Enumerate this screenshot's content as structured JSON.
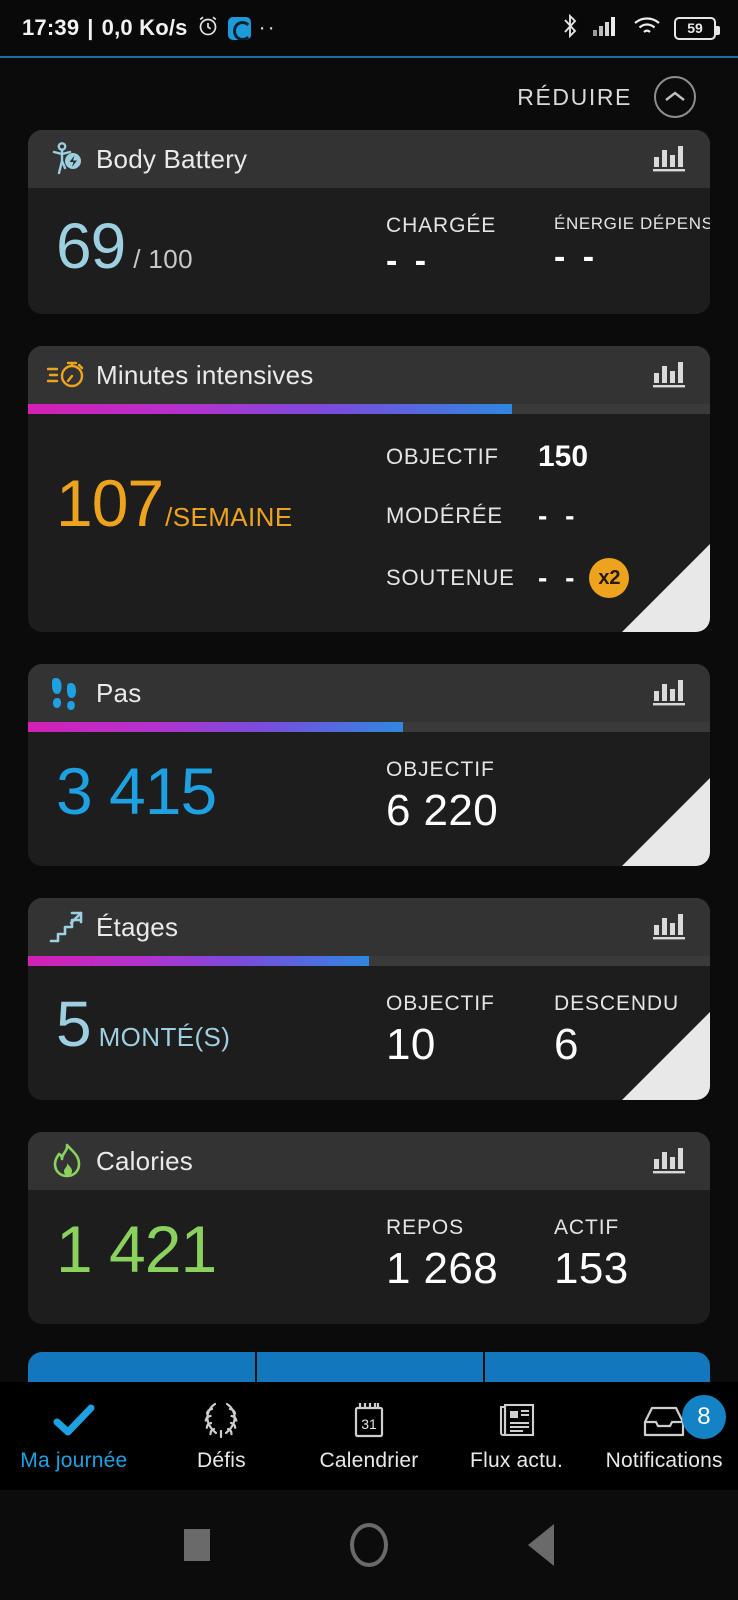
{
  "status_bar": {
    "time": "17:39",
    "separator": "|",
    "network_speed": "0,0 Ko/s",
    "alarm_icon": "alarm-clock-icon",
    "app_icon": "app-icon",
    "more_dots": "··",
    "bluetooth_icon": "bluetooth-icon",
    "signal_icon": "cellular-signal-icon",
    "wifi_icon": "wifi-icon",
    "battery_level": "59"
  },
  "header": {
    "reduce_label": "RÉDUIRE",
    "reduce_icon": "chevron-up-circle-icon"
  },
  "cards": [
    {
      "id": "body-battery",
      "title": "Body Battery",
      "icon": "body-battery-icon",
      "accent": "#9dcfe0",
      "value": "69",
      "unit": "/ 100",
      "has_progress": false,
      "has_corner": false,
      "layout": "columns",
      "stats": [
        {
          "label": "CHARGÉE",
          "value": "- -",
          "small_label": false
        },
        {
          "label": "ÉNERGIE DÉPENSÉE",
          "value": "- -",
          "small_label": true
        }
      ]
    },
    {
      "id": "minutes-intensives",
      "title": "Minutes intensives",
      "icon": "stopwatch-icon",
      "accent": "#eda31e",
      "value": "107",
      "unit": "/SEMAINE",
      "has_progress": true,
      "progress_percent": 71,
      "has_corner": true,
      "layout": "rows",
      "stats": [
        {
          "label": "OBJECTIF",
          "value": "150",
          "badge": ""
        },
        {
          "label": "MODÉRÉE",
          "value": "- -",
          "badge": ""
        },
        {
          "label": "SOUTENUE",
          "value": "- -",
          "badge": "x2"
        }
      ]
    },
    {
      "id": "pas",
      "title": "Pas",
      "icon": "footprints-icon",
      "accent": "#1ea1e2",
      "value": "3 415",
      "unit": "",
      "has_progress": true,
      "progress_percent": 55,
      "has_corner": true,
      "layout": "columns",
      "stats": [
        {
          "label": "OBJECTIF",
          "value": "6 220",
          "small_label": false
        }
      ]
    },
    {
      "id": "etages",
      "title": "Étages",
      "icon": "stairs-icon",
      "accent": "#9dcfe0",
      "value": "5",
      "unit": "MONTÉ(S)",
      "has_progress": true,
      "progress_percent": 50,
      "has_corner": true,
      "layout": "columns",
      "stats": [
        {
          "label": "OBJECTIF",
          "value": "10",
          "small_label": false
        },
        {
          "label": "DESCENDU",
          "value": "6",
          "small_label": false
        }
      ]
    },
    {
      "id": "calories",
      "title": "Calories",
      "icon": "flame-icon",
      "accent": "#8bd15e",
      "value": "1 421",
      "unit": "",
      "has_progress": false,
      "has_corner": false,
      "layout": "columns",
      "stats": [
        {
          "label": "REPOS",
          "value": "1 268",
          "small_label": false
        },
        {
          "label": "ACTIF",
          "value": "153",
          "small_label": false
        }
      ]
    }
  ],
  "bottom_nav": {
    "items": [
      {
        "label": "Ma journée",
        "icon": "checkmark-icon",
        "active": true,
        "badge": ""
      },
      {
        "label": "Défis",
        "icon": "laurel-wreath-icon",
        "active": false,
        "badge": ""
      },
      {
        "label": "Calendrier",
        "icon": "calendar-icon",
        "active": false,
        "badge": "",
        "calendar_day": "31"
      },
      {
        "label": "Flux actu.",
        "icon": "news-feed-icon",
        "active": false,
        "badge": ""
      },
      {
        "label": "Notifications",
        "icon": "inbox-icon",
        "active": false,
        "badge": "8"
      }
    ]
  },
  "android_nav": {
    "recents_icon": "square-recents-icon",
    "home_icon": "circle-home-icon",
    "back_icon": "triangle-back-icon"
  }
}
